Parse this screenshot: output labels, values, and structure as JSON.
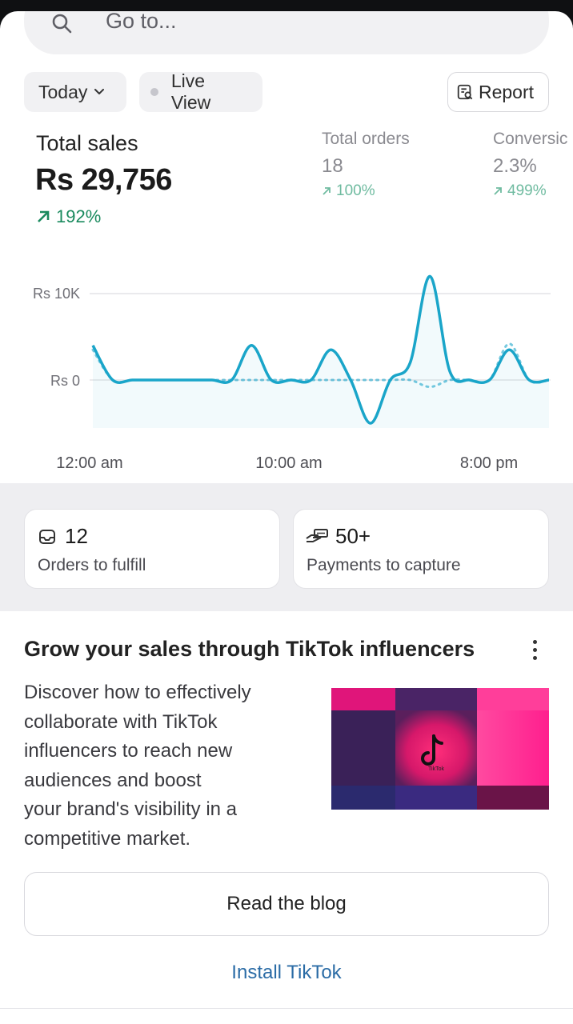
{
  "search": {
    "placeholder": "Go to..."
  },
  "filters": {
    "date_label": "Today",
    "live_label": "Live View",
    "report_label": "Report"
  },
  "metrics": {
    "total_sales": {
      "label": "Total sales",
      "value": "Rs 29,756",
      "change": "192%"
    },
    "total_orders": {
      "label": "Total orders",
      "value": "18",
      "change": "100%"
    },
    "conversion": {
      "label": "Conversic",
      "value": "2.3%",
      "change": "499%"
    }
  },
  "chart_data": {
    "type": "line",
    "y_ticks": [
      "Rs 10K",
      "Rs 0"
    ],
    "x_ticks": [
      "12:00 am",
      "10:00 am",
      "8:00 pm"
    ],
    "ylim": [
      -5000,
      12000
    ],
    "grid": true,
    "x": [
      0,
      1,
      2,
      3,
      4,
      5,
      6,
      7,
      8,
      9,
      10,
      11,
      12,
      13,
      14,
      15,
      16,
      17,
      18,
      19,
      20,
      21,
      22,
      23
    ],
    "series": [
      {
        "role": "current",
        "color": "#1aa5c9",
        "style": "solid",
        "values": [
          4000,
          0,
          0,
          0,
          0,
          0,
          0,
          0,
          4000,
          0,
          0,
          0,
          3500,
          0,
          -5000,
          0,
          2000,
          12000,
          1000,
          0,
          0,
          3500,
          0,
          0
        ]
      },
      {
        "role": "comparison",
        "color": "#1aa5c9",
        "style": "dotted",
        "values": [
          3500,
          0,
          0,
          0,
          0,
          0,
          0,
          0,
          0,
          0,
          0,
          0,
          0,
          0,
          0,
          0,
          0,
          -800,
          0,
          0,
          0,
          4200,
          0,
          0
        ]
      }
    ]
  },
  "cards": {
    "orders": {
      "count": "12",
      "label": "Orders to fulfill"
    },
    "payments": {
      "count": "50+",
      "label": "Payments to capture"
    }
  },
  "promo": {
    "title": "Grow your sales through TikTok influencers",
    "body_lines": [
      "Discover how to effectively",
      "collaborate with TikTok",
      "influencers to reach new",
      "audiences and boost",
      "your brand's visibility in a",
      "competitive market."
    ],
    "image_caption": "TikTok",
    "button_label": "Read the blog",
    "link_label": "Install TikTok"
  },
  "colors": {
    "accent": "#1aa5c9",
    "positive": "#1a8a5e",
    "link": "#2b6ca6"
  }
}
